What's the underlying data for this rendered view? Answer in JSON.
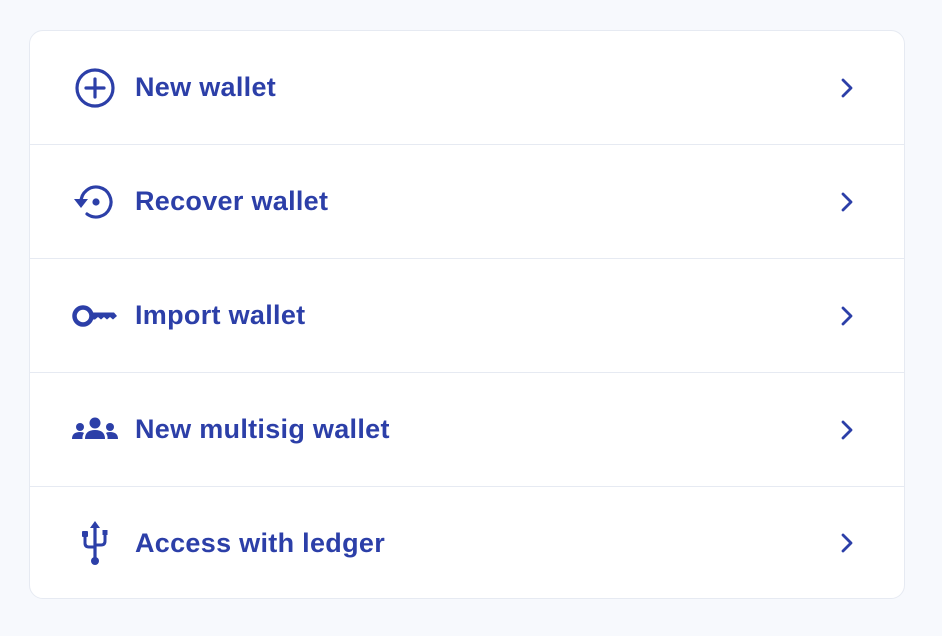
{
  "menu": {
    "items": [
      {
        "label": "New wallet",
        "icon": "plus-circle-icon"
      },
      {
        "label": "Recover wallet",
        "icon": "restore-icon"
      },
      {
        "label": "Import wallet",
        "icon": "key-icon"
      },
      {
        "label": "New multisig wallet",
        "icon": "group-icon"
      },
      {
        "label": "Access with ledger",
        "icon": "usb-icon"
      }
    ]
  },
  "colors": {
    "accent": "#2c3fa8",
    "background": "#f7f9fd",
    "card": "#ffffff",
    "divider": "#e6eaf2"
  }
}
